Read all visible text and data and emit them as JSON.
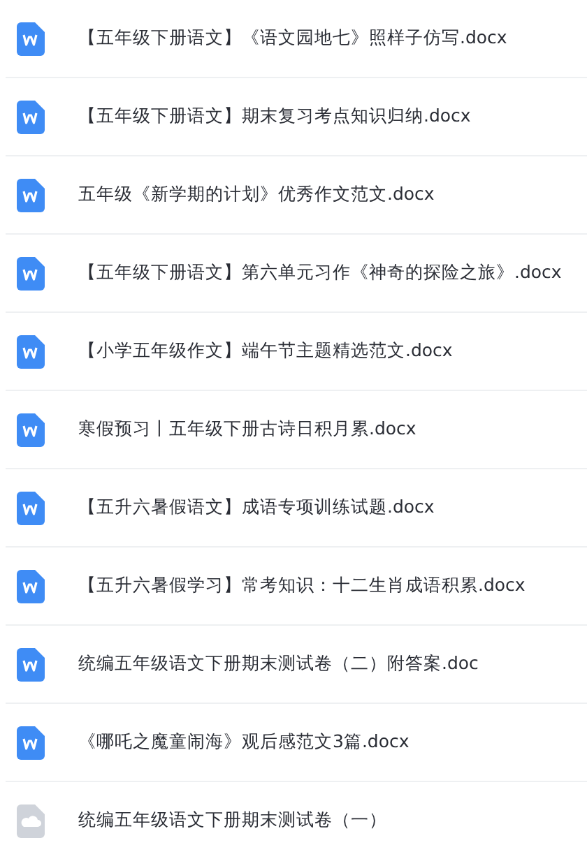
{
  "files": [
    {
      "kind": "word",
      "name": "【五年级下册语文】《语文园地七》照样子仿写.docx"
    },
    {
      "kind": "word",
      "name": "【五年级下册语文】期末复习考点知识归纳.docx"
    },
    {
      "kind": "word",
      "name": "五年级《新学期的计划》优秀作文范文.docx"
    },
    {
      "kind": "word",
      "name": "【五年级下册语文】第六单元习作《神奇的探险之旅》.docx"
    },
    {
      "kind": "word",
      "name": "【小学五年级作文】端午节主题精选范文.docx"
    },
    {
      "kind": "word",
      "name": "寒假预习丨五年级下册古诗日积月累.docx"
    },
    {
      "kind": "word",
      "name": "【五升六暑假语文】成语专项训练试题.docx"
    },
    {
      "kind": "word",
      "name": "【五升六暑假学习】常考知识：十二生肖成语积累.docx"
    },
    {
      "kind": "word",
      "name": "统编五年级语文下册期末测试卷（二）附答案.doc"
    },
    {
      "kind": "word",
      "name": "《哪吒之魔童闹海》观后感范文3篇.docx"
    },
    {
      "kind": "cloud",
      "name": "统编五年级语文下册期末测试卷（一）"
    }
  ]
}
